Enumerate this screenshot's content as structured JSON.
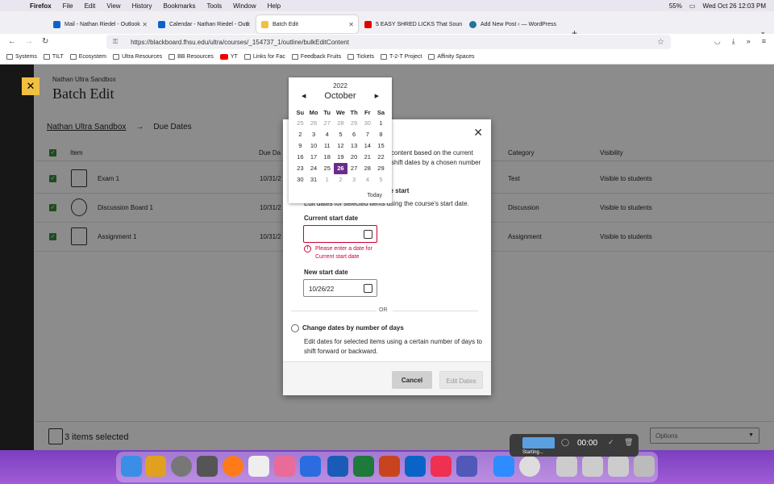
{
  "menubar": {
    "app": "Firefox",
    "items": [
      "File",
      "Edit",
      "View",
      "History",
      "Bookmarks",
      "Tools",
      "Window",
      "Help"
    ],
    "battery": "55%",
    "clock": "Wed Oct 26  12:03 PM"
  },
  "tabs": [
    {
      "title": "Mail - Nathan Riedel - Outlook",
      "color": "#0a64c8"
    },
    {
      "title": "Calendar - Nathan Riedel - Outl",
      "color": "#0a64c8"
    },
    {
      "title": "Batch Edit",
      "color": "#f2c040"
    },
    {
      "title": "5 EASY SHRED LICKS That Soun",
      "color": "#e00000"
    },
    {
      "title": "Add New Post ‹ — WordPress",
      "color": "#21759b"
    }
  ],
  "url": "https://blackboard.fhsu.edu/ultra/courses/_154737_1/outline/bulkEditContent",
  "bookmarks": [
    "Systems",
    "TILT",
    "Ecosystem",
    "Ultra Resources",
    "BB Resources",
    "YT",
    "Links for Fac",
    "Feedback Fruits",
    "Tickets",
    "T-2-T Project",
    "Affinity Spaces"
  ],
  "page": {
    "course_crumb": "Nathan Ultra Sandbox",
    "title": "Batch Edit",
    "sub_course": "Nathan Ultra Sandbox",
    "sub_page": "Due Dates",
    "columns": {
      "item": "Item",
      "due": "Due Da",
      "category": "Category",
      "visibility": "Visibility"
    },
    "rows": [
      {
        "name": "Exam 1",
        "due": "10/31/2",
        "category": "Test",
        "visibility": "Visible to students"
      },
      {
        "name": "Discussion Board 1",
        "due": "10/31/2",
        "category": "Discussion",
        "visibility": "Visible to students"
      },
      {
        "name": "Assignment 1",
        "due": "10/31/2",
        "category": "Assignment",
        "visibility": "Visible to students"
      }
    ],
    "selected_count": "3 items selected",
    "options_placeholder": "Options"
  },
  "modal": {
    "intro": "content based on the current shift dates by a chosen number",
    "option_a_title": "se start",
    "option_a_desc": "Edit dates for selected items using the course's start date.",
    "current_label": "Current start date",
    "current_value": "",
    "error": "Please enter a date for Current start date",
    "new_label": "New start date",
    "new_value": "10/26/22",
    "or": "OR",
    "option_b_title": "Change dates by number of days",
    "option_b_desc": "Edit dates for selected items using a certain number of days to shift forward or backward.",
    "cancel": "Cancel",
    "edit_dates": "Edit Dates"
  },
  "calendar": {
    "year": "2022",
    "month": "October",
    "weekdays": [
      "Su",
      "Mo",
      "Tu",
      "We",
      "Th",
      "Fr",
      "Sa"
    ],
    "weeks": [
      [
        "25",
        "26",
        "27",
        "28",
        "29",
        "30",
        "1"
      ],
      [
        "2",
        "3",
        "4",
        "5",
        "6",
        "7",
        "8"
      ],
      [
        "9",
        "10",
        "11",
        "12",
        "13",
        "14",
        "15"
      ],
      [
        "16",
        "17",
        "18",
        "19",
        "20",
        "21",
        "22"
      ],
      [
        "23",
        "24",
        "25",
        "26",
        "27",
        "28",
        "29"
      ],
      [
        "30",
        "31",
        "1",
        "2",
        "3",
        "4",
        "5"
      ]
    ],
    "selected": "26",
    "today": "Today"
  },
  "recorder": {
    "time": "00:00",
    "status": "Starting..."
  }
}
